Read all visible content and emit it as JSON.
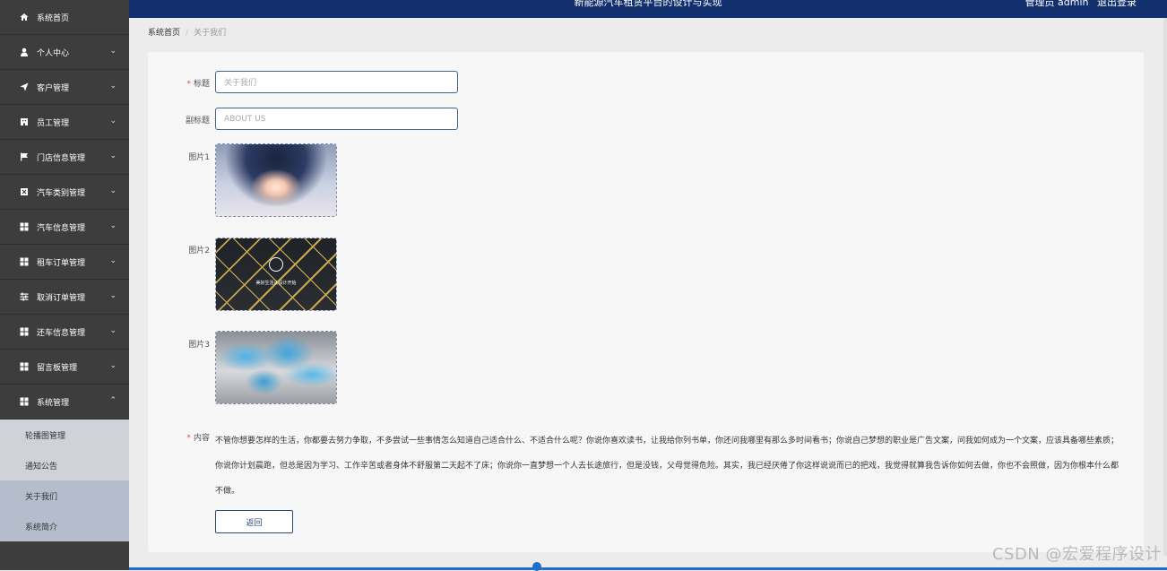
{
  "header": {
    "title": "新能源汽车租赁平台的设计与实现",
    "user_label": "管理员 admin",
    "logout_label": "退出登录"
  },
  "sidebar": {
    "items": [
      {
        "label": "系统首页",
        "icon": "home-icon",
        "chevron": ""
      },
      {
        "label": "个人中心",
        "icon": "user-icon",
        "chevron": "⌄"
      },
      {
        "label": "客户管理",
        "icon": "send-icon",
        "chevron": "⌄"
      },
      {
        "label": "员工管理",
        "icon": "building-icon",
        "chevron": "⌄"
      },
      {
        "label": "门店信息管理",
        "icon": "flag-icon",
        "chevron": "⌄"
      },
      {
        "label": "汽车类别管理",
        "icon": "box-icon",
        "chevron": "⌄"
      },
      {
        "label": "汽车信息管理",
        "icon": "grid-icon",
        "chevron": "⌄"
      },
      {
        "label": "租车订单管理",
        "icon": "grid-icon",
        "chevron": "⌄"
      },
      {
        "label": "取消订单管理",
        "icon": "sliders-icon",
        "chevron": "⌄"
      },
      {
        "label": "还车信息管理",
        "icon": "grid-icon",
        "chevron": "⌄"
      },
      {
        "label": "留言板管理",
        "icon": "grid-icon",
        "chevron": "⌄"
      },
      {
        "label": "系统管理",
        "icon": "grid-icon",
        "chevron": "⌃"
      }
    ],
    "subitems": [
      {
        "label": "轮播图管理"
      },
      {
        "label": "通知公告"
      },
      {
        "label": "关于我们"
      },
      {
        "label": "系统简介"
      }
    ]
  },
  "breadcrumb": {
    "home": "系统首页",
    "separator": "/",
    "current": "关于我们"
  },
  "form": {
    "title_label": "标题",
    "title_value": "关于我们",
    "subtitle_label": "副标题",
    "subtitle_value": "ABOUT US",
    "image1_label": "图片1",
    "image2_label": "图片2",
    "image2_caption": "美好生活从设计开始",
    "image3_label": "图片3",
    "content_label": "内容",
    "content_text": "不管你想要怎样的生活，你都要去努力争取，不多尝试一些事情怎么知道自己适合什么、不适合什么呢？你说你喜欢读书，让我给你列书单，你还问我哪里有那么多时间看书；你说自己梦想的职业是广告文案，问我如何成为一个文案，应该具备哪些素质；你说你计划晨跑，但总是因为学习、工作辛苦或者身体不舒服第二天起不了床；你说你一直梦想一个人去长途旅行，但是没钱，父母觉得危险。其实，我已经厌倦了你这样说说而已的把戏，我觉得就算我告诉你如何去做，你也不会照做，因为你根本什么都不做。",
    "required_mark": "*",
    "back_label": "返回"
  },
  "watermark": "CSDN @宏爱程序设计"
}
